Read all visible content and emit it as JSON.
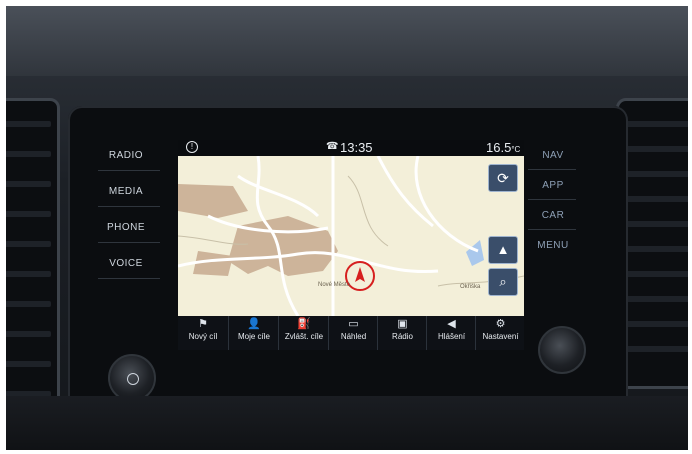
{
  "status_bar": {
    "clock": "13:35",
    "temperature": "16.5",
    "temperature_unit": "°C"
  },
  "left_buttons": [
    "RADIO",
    "MEDIA",
    "PHONE",
    "VOICE"
  ],
  "right_buttons": [
    "NAV",
    "APP",
    "CAR",
    "MENU"
  ],
  "map": {
    "labels": [
      "Nové Město",
      "Okřiška"
    ],
    "colors": {
      "background": "#f3efd9",
      "urban": "#cdb49a",
      "roads": "#ffffff",
      "water": "#aac8ec",
      "position_marker": "#d61f1f"
    }
  },
  "toolbar": [
    {
      "label": "Nový cíl",
      "icon": "flag-icon"
    },
    {
      "label": "Moje cíle",
      "icon": "person-icon"
    },
    {
      "label": "Zvlášt. cíle",
      "icon": "poi-icon"
    },
    {
      "label": "Náhled",
      "icon": "map-preview-icon"
    },
    {
      "label": "Rádio",
      "icon": "radio-icon"
    },
    {
      "label": "Hlášení",
      "icon": "megaphone-icon"
    },
    {
      "label": "Nastavení",
      "icon": "gear-icon"
    }
  ]
}
